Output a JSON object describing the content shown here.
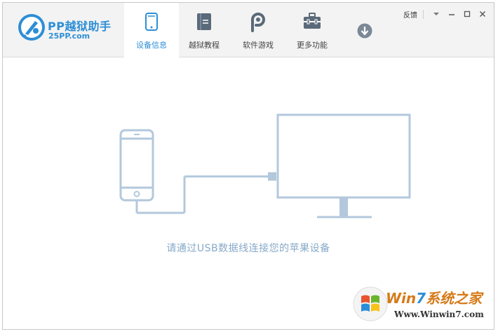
{
  "app": {
    "title": "PP越狱助手",
    "subtitle": "25PP.com"
  },
  "tabs": [
    {
      "label": "设备信息",
      "icon": "phone-icon",
      "active": true
    },
    {
      "label": "越狱教程",
      "icon": "book-icon",
      "active": false
    },
    {
      "label": "软件游戏",
      "icon": "pp-logo-icon",
      "active": false
    },
    {
      "label": "更多功能",
      "icon": "toolbox-icon",
      "active": false
    }
  ],
  "system": {
    "feedback_label": "反馈"
  },
  "main": {
    "hint": "请通过USB数据线连接您的苹果设备"
  },
  "watermark": {
    "brand_prefix": "Win",
    "brand_seven": "7",
    "brand_suffix": "系统之家",
    "url": "Www.Winwin7.com"
  },
  "colors": {
    "accent": "#2d8ed6",
    "illustration": "#b3c8dc",
    "hint_text": "#86a9c8",
    "titlebar_bg": "#f3f3f3"
  }
}
